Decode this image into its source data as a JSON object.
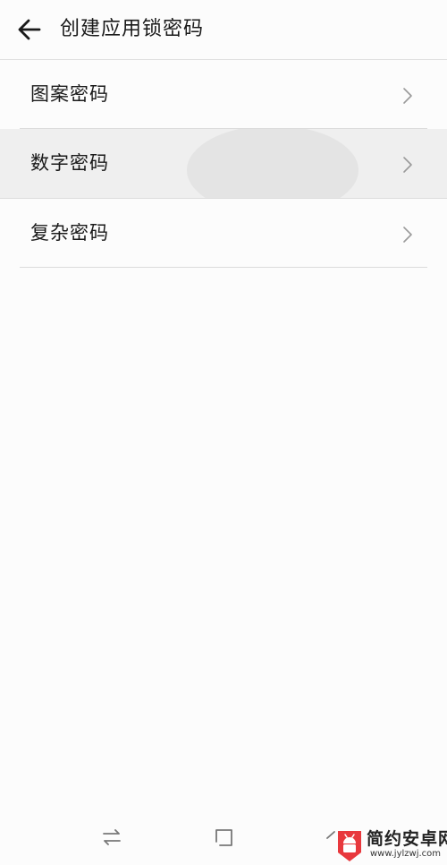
{
  "header": {
    "title": "创建应用锁密码",
    "back_icon": "arrow-left-icon"
  },
  "items": [
    {
      "label": "图案密码",
      "icon": "chevron-right-icon"
    },
    {
      "label": "数字密码",
      "icon": "chevron-right-icon",
      "pressed": true
    },
    {
      "label": "复杂密码",
      "icon": "chevron-right-icon"
    }
  ],
  "navbar": {
    "buttons": [
      "switch-icon",
      "home-square-icon",
      "back-triangle-icon"
    ]
  },
  "watermark": {
    "logo": "android-logo",
    "name": "简约安卓网",
    "url": "www.jylzwj.com"
  },
  "colors": {
    "background": "#fcfcfc",
    "pressed": "#efefef",
    "divider": "#dcdcdc",
    "text": "#1a1a1a",
    "chevron": "#9a9a9a",
    "logo_red": "#e8383d"
  }
}
